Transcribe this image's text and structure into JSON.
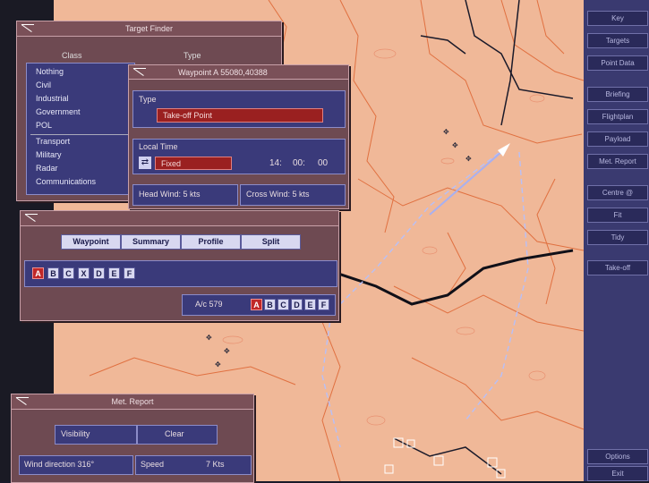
{
  "target_finder": {
    "title": "Target Finder",
    "class_header": "Class",
    "type_header": "Type",
    "classes": [
      "Nothing",
      "Civil",
      "Industrial",
      "Government",
      "POL",
      "Transport",
      "Military",
      "Radar",
      "Communications"
    ]
  },
  "waypoint": {
    "title": "Waypoint A 55080,40388",
    "type_label": "Type",
    "type_value": "Take-off Point",
    "local_time_label": "Local Time",
    "time_mode": "Fixed",
    "time_h": "14:",
    "time_m": "00:",
    "time_s": "00",
    "head_wind": "Head Wind:  5 kts",
    "cross_wind": "Cross Wind:  5 kts"
  },
  "flightplan": {
    "tabs": [
      "Waypoint",
      "Summary",
      "Profile",
      "Split"
    ],
    "waypoints": [
      "A",
      "B",
      "C",
      "X",
      "D",
      "E",
      "F"
    ],
    "aircraft_label": "A/c 579",
    "ac_waypoints": [
      "A",
      "B",
      "C",
      "D",
      "E",
      "F"
    ]
  },
  "met_report": {
    "title": "Met. Report",
    "visibility_label": "Visibility",
    "visibility_value": "Clear",
    "wind_direction": "Wind direction  316°",
    "speed_label": "Speed",
    "speed_value": "7  Kts"
  },
  "right_menu": {
    "buttons": [
      "Key",
      "Targets",
      "Point Data",
      "Briefing",
      "Flightplan",
      "Payload",
      "Met. Report",
      "Centre @",
      "Fit",
      "Tidy",
      "Take-off"
    ],
    "bottom_buttons": [
      "Options",
      "Exit"
    ]
  },
  "colors": {
    "map": "#f0b898",
    "panel": "#6e4a52",
    "field_blue": "#3a3a7a",
    "accent_red": "#9a2020",
    "menu_bg": "#3a3a70"
  }
}
